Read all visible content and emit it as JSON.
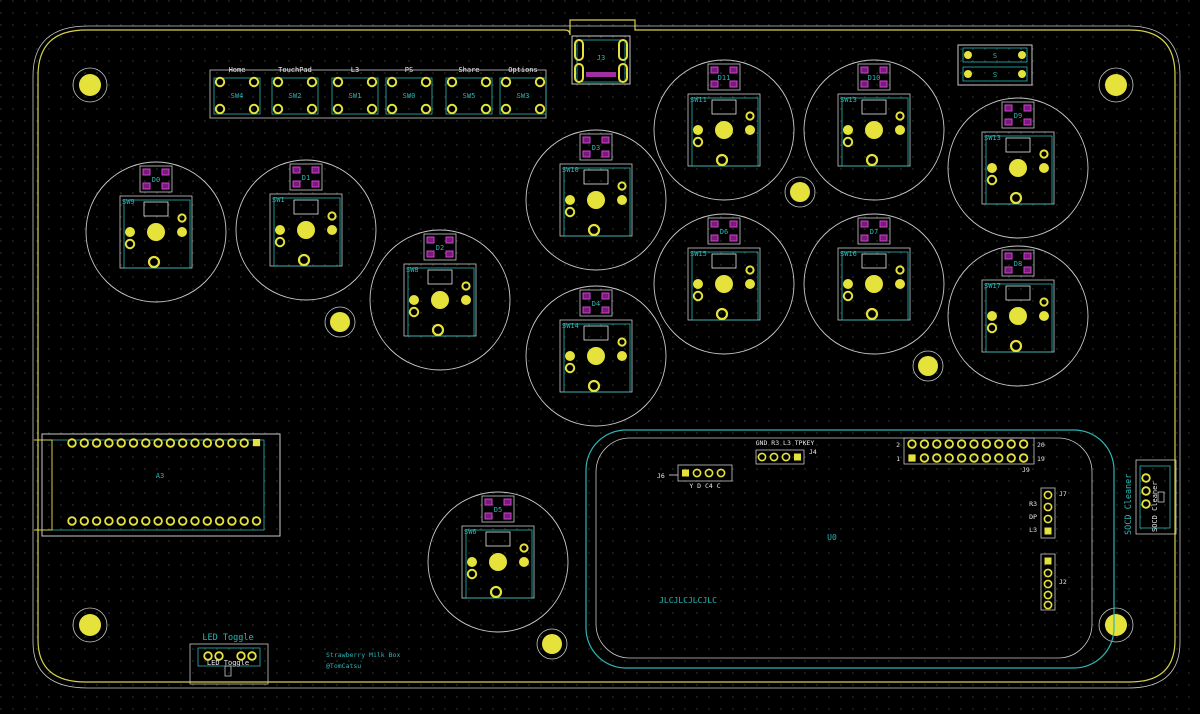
{
  "colors": {
    "background": "#000000",
    "grid": "#2b3a2b",
    "edge": "#d6d14a",
    "courtyard": "#c8c8c8",
    "pad": "#e6e23c",
    "fab": "#2bb5b5",
    "silk": "#e8e8e8",
    "smd": "#7a1a7a",
    "smd_border": "#d040d0"
  },
  "tact_switches": [
    {
      "ref": "SW4",
      "label": "Home"
    },
    {
      "ref": "SW2",
      "label": "TouchPad"
    },
    {
      "ref": "SW1",
      "label": "L3"
    },
    {
      "ref": "SW0",
      "label": "PS"
    },
    {
      "ref": "SW5",
      "label": "Share"
    },
    {
      "ref": "SW3",
      "label": "Options"
    }
  ],
  "buttons": [
    {
      "sw": "SW9",
      "led": "D0"
    },
    {
      "sw": "SW1",
      "led": "D1"
    },
    {
      "sw": "SW8",
      "led": "D2"
    },
    {
      "sw": "SW10",
      "led": "D3"
    },
    {
      "sw": "SW14",
      "led": "D4"
    },
    {
      "sw": "SW11",
      "led": "D11"
    },
    {
      "sw": "SW15",
      "led": "D6"
    },
    {
      "sw": "SW13",
      "led": "D10"
    },
    {
      "sw": "SW16",
      "led": "D7"
    },
    {
      "sw": "SW13",
      "led": "D9"
    },
    {
      "sw": "SW17",
      "led": "D8"
    },
    {
      "sw": "SW6",
      "led": "D5"
    }
  ],
  "labels": {
    "usb": "J3",
    "mcu": "A3",
    "module": "U0",
    "jlc": "JLCJLCJLCJLC",
    "header_j4_title": "GND R3 L3 TPKEY",
    "header_j4_ref": "J4",
    "header_j6_ref": "J6",
    "header_j6_pins": "Y  D  C4  C",
    "header_j9_ref": "J9",
    "header_j9_pin_a": "2",
    "header_j9_pin_b": "1",
    "header_j9_pin_c": "20",
    "header_j9_pin_d": "19",
    "header_j7_ref": "J7",
    "header_j7_r3": "R3",
    "header_j7_dp": "DP",
    "header_j7_l3": "L3",
    "header_j2_ref": "J2",
    "socd_title": "SOCD Cleaner",
    "led_toggle": "LED Toggle",
    "credit_line1": "Strawberry Milk Box",
    "credit_line2": "@TomCatsu",
    "top_right_a": "S",
    "top_right_b": "S"
  }
}
